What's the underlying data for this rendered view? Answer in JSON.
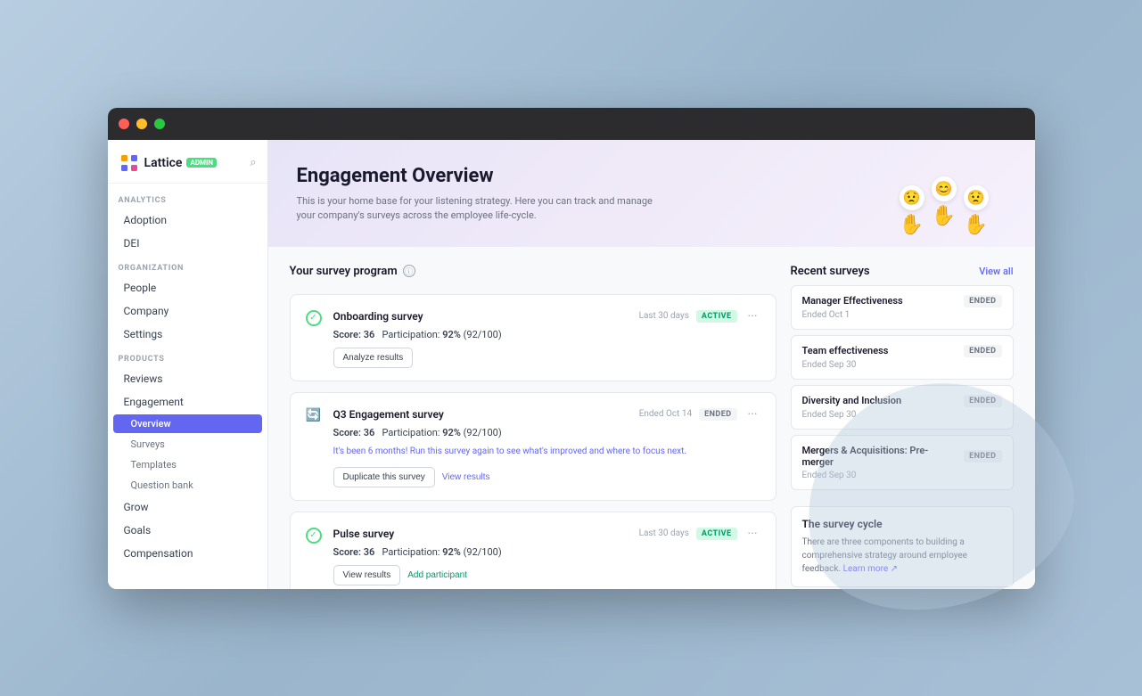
{
  "browser": {
    "traffic_lights": [
      "red",
      "yellow",
      "green"
    ]
  },
  "sidebar": {
    "logo_text": "Lattice",
    "admin_badge": "Admin",
    "search_icon": "⌕",
    "analytics_label": "ANALYTICS",
    "analytics_items": [
      {
        "label": "Adoption",
        "id": "adoption"
      },
      {
        "label": "DEI",
        "id": "dei"
      }
    ],
    "organization_label": "ORGANIZATION",
    "organization_items": [
      {
        "label": "People",
        "id": "people"
      },
      {
        "label": "Company",
        "id": "company"
      },
      {
        "label": "Settings",
        "id": "settings"
      }
    ],
    "products_label": "PRODUCTS",
    "products_items": [
      {
        "label": "Reviews",
        "id": "reviews"
      },
      {
        "label": "Engagement",
        "id": "engagement",
        "expanded": true
      },
      {
        "label": "Grow",
        "id": "grow"
      },
      {
        "label": "Goals",
        "id": "goals"
      },
      {
        "label": "Compensation",
        "id": "compensation"
      }
    ],
    "engagement_subitems": [
      {
        "label": "Overview",
        "id": "overview",
        "active": true
      },
      {
        "label": "Surveys",
        "id": "surveys"
      },
      {
        "label": "Templates",
        "id": "templates"
      },
      {
        "label": "Question bank",
        "id": "question-bank"
      }
    ]
  },
  "hero": {
    "title": "Engagement Overview",
    "subtitle": "This is your home base for your listening strategy. Here you can track and manage your company's surveys across the employee life-cycle.",
    "emoji_faces": [
      "😟",
      "😊",
      "😟"
    ]
  },
  "survey_program": {
    "section_title": "Your survey program",
    "cards": [
      {
        "id": "onboarding",
        "status_type": "check",
        "title": "Onboarding survey",
        "meta": "Last 30 days",
        "badge": "ACTIVE",
        "badge_type": "active",
        "score_label": "Score:",
        "score_value": "36",
        "participation_label": "Participation:",
        "participation_pct": "92%",
        "participation_count": "(92/100)",
        "actions": [
          {
            "label": "Analyze results",
            "type": "secondary"
          }
        ],
        "note": null
      },
      {
        "id": "q3-engagement",
        "status_type": "reload",
        "title": "Q3 Engagement survey",
        "meta": "Ended Oct 14",
        "badge": "ENDED",
        "badge_type": "ended",
        "score_label": "Score:",
        "score_value": "36",
        "participation_label": "Participation:",
        "participation_pct": "92%",
        "participation_count": "(92/100)",
        "note": "It's been 6 months! Run this survey again to see what's improved and where to focus next.",
        "actions": [
          {
            "label": "Duplicate this survey",
            "type": "secondary"
          },
          {
            "label": "View results",
            "type": "link"
          }
        ]
      },
      {
        "id": "pulse",
        "status_type": "check",
        "title": "Pulse survey",
        "meta": "Last 30 days",
        "badge": "ACTIVE",
        "badge_type": "active",
        "score_label": "Score:",
        "score_value": "36",
        "participation_label": "Participation:",
        "participation_pct": "92%",
        "participation_count": "(92/100)",
        "note": null,
        "actions": [
          {
            "label": "View results",
            "type": "secondary"
          },
          {
            "label": "Add participant",
            "type": "link-green"
          }
        ]
      }
    ]
  },
  "recent_surveys": {
    "section_title": "Recent surveys",
    "view_all_label": "View all",
    "items": [
      {
        "title": "Manager Effectiveness",
        "badge": "ENDED",
        "date_label": "Ended Oct 1"
      },
      {
        "title": "Team effectiveness",
        "badge": "ENDED",
        "date_label": "Ended Sep 30"
      },
      {
        "title": "Diversity and Inclusion",
        "badge": "ENDED",
        "date_label": "Ended Sep 30"
      },
      {
        "title": "Mergers & Acquisitions: Pre-merger",
        "badge": "ENDED",
        "date_label": "Ended Sep 30"
      }
    ]
  },
  "survey_cycle": {
    "title": "The survey cycle",
    "text": "There are three components to building a comprehensive strategy around employee feedback.",
    "learn_more_label": "Learn more",
    "learn_more_icon": "↗"
  }
}
